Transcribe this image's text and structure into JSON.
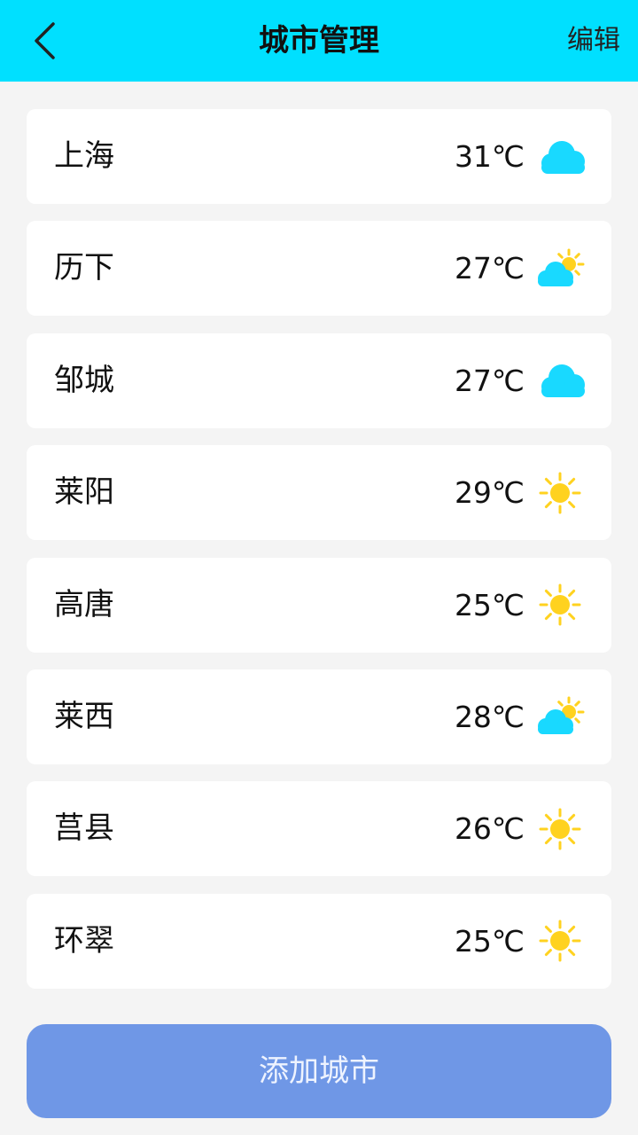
{
  "header": {
    "title": "城市管理",
    "edit_label": "编辑",
    "bg_color": "#00e0ff"
  },
  "cities": [
    {
      "name": "上海",
      "temp": "31℃",
      "weather_icon": "cloud-icon"
    },
    {
      "name": "历下",
      "temp": "27℃",
      "weather_icon": "partly-cloudy-icon"
    },
    {
      "name": "邹城",
      "temp": "27℃",
      "weather_icon": "cloud-icon"
    },
    {
      "name": "莱阳",
      "temp": "29℃",
      "weather_icon": "sun-icon"
    },
    {
      "name": "高唐",
      "temp": "25℃",
      "weather_icon": "sun-icon"
    },
    {
      "name": "莱西",
      "temp": "28℃",
      "weather_icon": "partly-cloudy-icon"
    },
    {
      "name": "莒县",
      "temp": "26℃",
      "weather_icon": "sun-icon"
    },
    {
      "name": "环翠",
      "temp": "25℃",
      "weather_icon": "sun-icon"
    }
  ],
  "add_button": {
    "label": "添加城市",
    "color": "#6f97e6"
  }
}
